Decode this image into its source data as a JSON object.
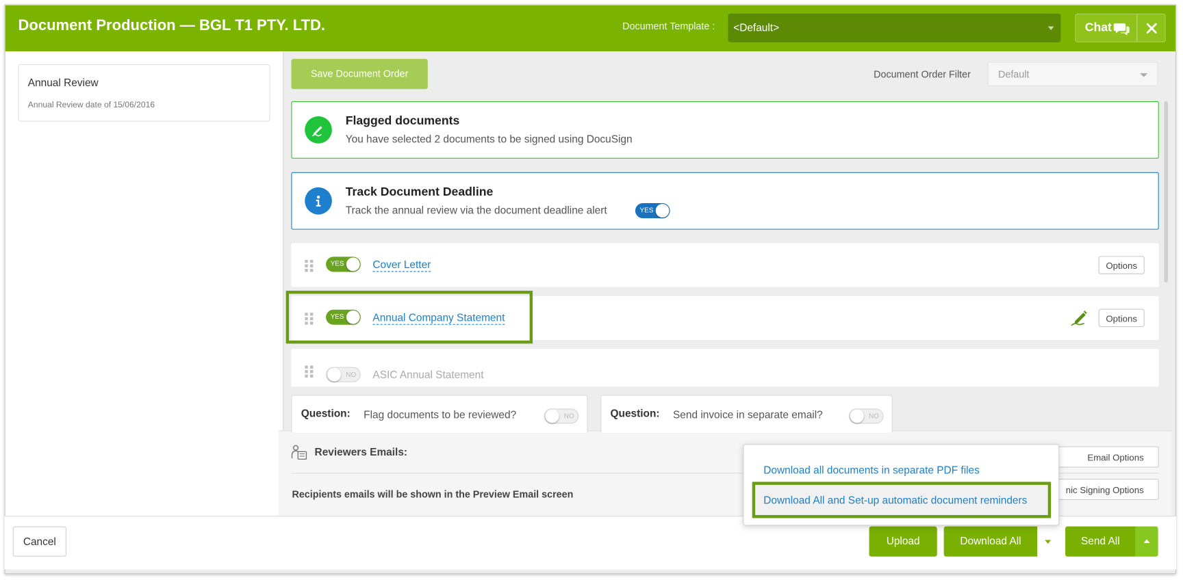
{
  "header": {
    "title": "Document Production — BGL T1 PTY. LTD.",
    "template_label": "Document Template :",
    "template_value": "<Default>",
    "chat_label": "Chat"
  },
  "sidebar": {
    "card_title": "Annual Review",
    "card_subtitle": "Annual Review date of 15/06/2016"
  },
  "toolbar": {
    "save_order_label": "Save Document Order",
    "filter_label": "Document Order Filter",
    "filter_value": "Default"
  },
  "notices": {
    "flagged": {
      "title": "Flagged documents",
      "text": "You have selected 2 documents to be signed using DocuSign"
    },
    "deadline": {
      "title": "Track Document Deadline",
      "text": "Track the annual review via the document deadline alert",
      "toggle": "YES"
    }
  },
  "documents": [
    {
      "name": "Cover Letter",
      "toggle": "YES",
      "options_label": "Options"
    },
    {
      "name": "Annual Company Statement",
      "toggle": "YES",
      "options_label": "Options"
    },
    {
      "name": "ASIC Annual Statement",
      "toggle": "NO"
    }
  ],
  "questions": [
    {
      "label": "Question:",
      "text": "Flag documents to be reviewed?",
      "toggle": "NO"
    },
    {
      "label": "Question:",
      "text": "Send invoice in separate email?",
      "toggle": "NO"
    }
  ],
  "email": {
    "reviewers_label": "Reviewers Emails:",
    "recipients_note": "Recipients emails will be shown in the Preview Email screen",
    "email_options": "Email Options",
    "signing_options": "nic Signing Options"
  },
  "download_menu": {
    "item_separate": "Download all documents in separate PDF files",
    "item_reminders": "Download All and Set-up automatic document reminders"
  },
  "footer": {
    "cancel": "Cancel",
    "upload": "Upload",
    "download_all": "Download All",
    "send_all": "Send All"
  },
  "colors": {
    "brand_green": "#7bb301",
    "link_blue": "#1f7fc8",
    "highlight_green": "#6c9c16"
  }
}
